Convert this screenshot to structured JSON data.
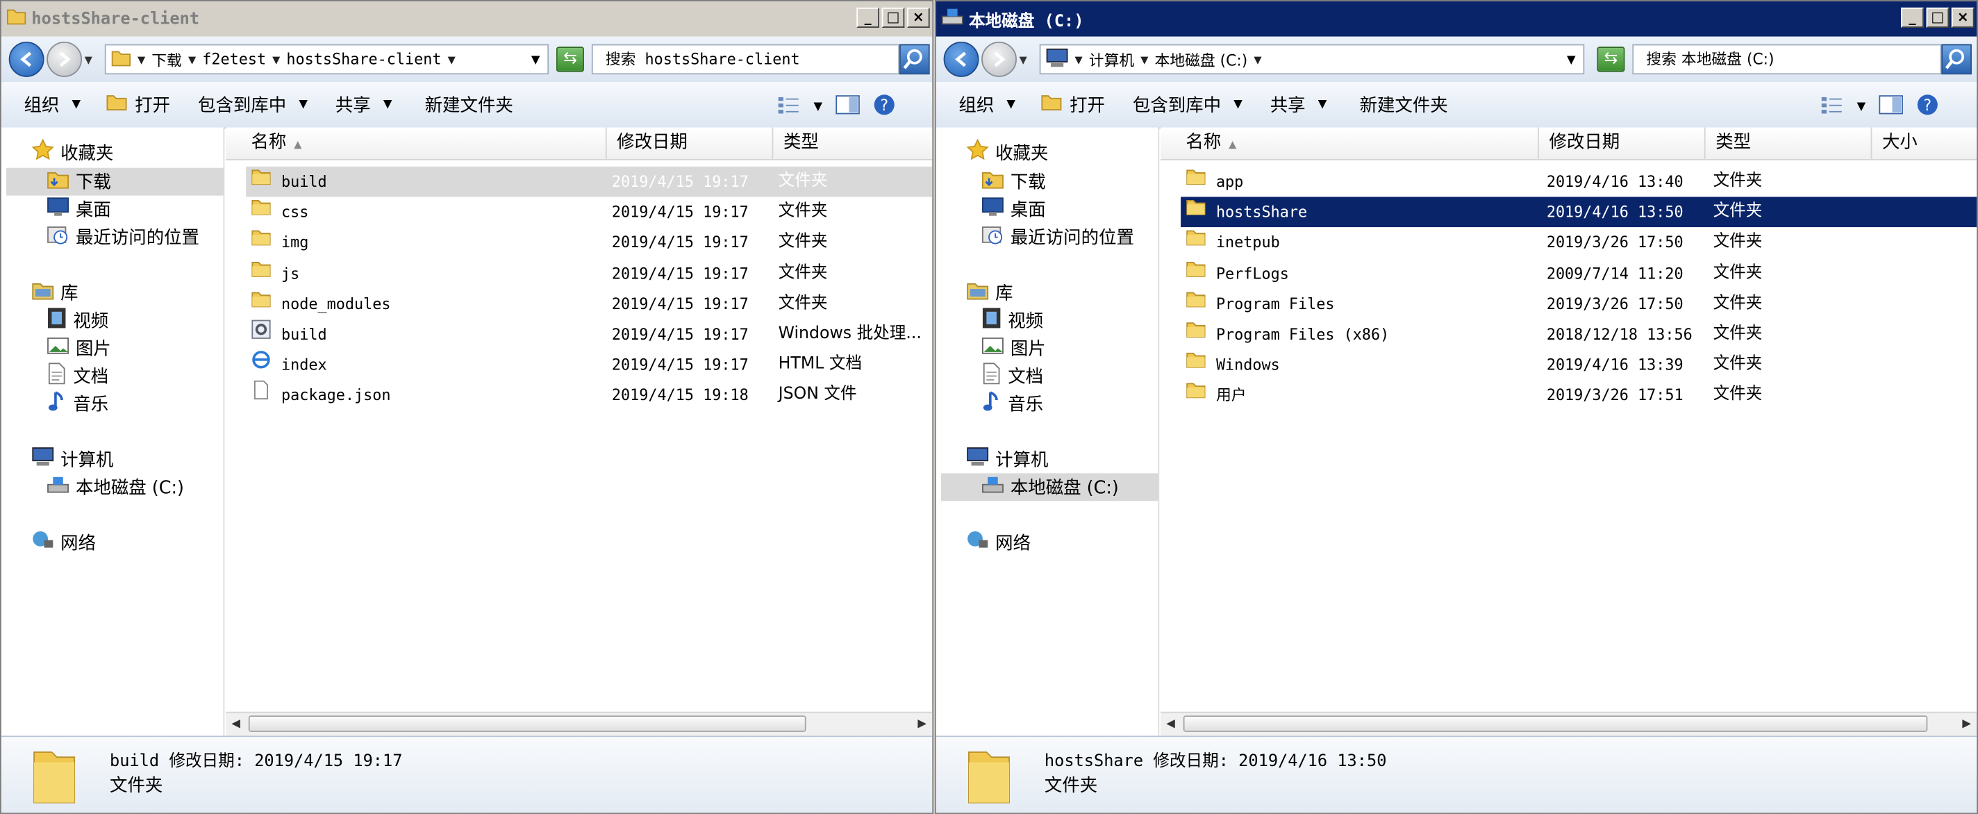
{
  "left_window": {
    "title": "hostsShare-client",
    "breadcrumb": [
      "下载",
      "f2etest",
      "hostsShare-client"
    ],
    "search_placeholder": "搜索 hostsShare-client",
    "toolbar": {
      "organize": "组织",
      "open": "打开",
      "include_library": "包含到库中",
      "share": "共享",
      "new_folder": "新建文件夹"
    },
    "nav": {
      "favorites": "收藏夹",
      "downloads": "下载",
      "desktop": "桌面",
      "recent": "最近访问的位置",
      "libraries": "库",
      "videos": "视频",
      "pictures": "图片",
      "documents": "文档",
      "music": "音乐",
      "computer": "计算机",
      "local_disk": "本地磁盘 (C:)",
      "network": "网络"
    },
    "columns": {
      "name": "名称",
      "date": "修改日期",
      "type": "类型"
    },
    "files": [
      {
        "name": "build",
        "date": "2019/4/15 19:17",
        "type": "文件夹",
        "icon": "folder-icon"
      },
      {
        "name": "css",
        "date": "2019/4/15 19:17",
        "type": "文件夹",
        "icon": "folder-icon"
      },
      {
        "name": "img",
        "date": "2019/4/15 19:17",
        "type": "文件夹",
        "icon": "folder-icon"
      },
      {
        "name": "js",
        "date": "2019/4/15 19:17",
        "type": "文件夹",
        "icon": "folder-icon"
      },
      {
        "name": "node_modules",
        "date": "2019/4/15 19:17",
        "type": "文件夹",
        "icon": "folder-icon"
      },
      {
        "name": "build",
        "date": "2019/4/15 19:17",
        "type": "Windows 批处理...",
        "icon": "batch-file-icon"
      },
      {
        "name": "index",
        "date": "2019/4/15 19:17",
        "type": "HTML 文档",
        "icon": "html-file-icon"
      },
      {
        "name": "package.json",
        "date": "2019/4/15 19:18",
        "type": "JSON 文件",
        "icon": "document-icon"
      }
    ],
    "details": {
      "line1": "build 修改日期: 2019/4/15 19:17",
      "line2": "文件夹"
    }
  },
  "right_window": {
    "title": "本地磁盘 (C:)",
    "breadcrumb": [
      "计算机",
      "本地磁盘 (C:)"
    ],
    "search_placeholder": "搜索 本地磁盘 (C:)",
    "toolbar": {
      "organize": "组织",
      "open": "打开",
      "include_library": "包含到库中",
      "share": "共享",
      "new_folder": "新建文件夹"
    },
    "nav": {
      "favorites": "收藏夹",
      "downloads": "下载",
      "desktop": "桌面",
      "recent": "最近访问的位置",
      "libraries": "库",
      "videos": "视频",
      "pictures": "图片",
      "documents": "文档",
      "music": "音乐",
      "computer": "计算机",
      "local_disk": "本地磁盘 (C:)",
      "network": "网络"
    },
    "columns": {
      "name": "名称",
      "date": "修改日期",
      "type": "类型",
      "size": "大小"
    },
    "files": [
      {
        "name": "app",
        "date": "2019/4/16 13:40",
        "type": "文件夹"
      },
      {
        "name": "hostsShare",
        "date": "2019/4/16 13:50",
        "type": "文件夹"
      },
      {
        "name": "inetpub",
        "date": "2019/3/26 17:50",
        "type": "文件夹"
      },
      {
        "name": "PerfLogs",
        "date": "2009/7/14 11:20",
        "type": "文件夹"
      },
      {
        "name": "Program Files",
        "date": "2019/3/26 17:50",
        "type": "文件夹"
      },
      {
        "name": "Program Files (x86)",
        "date": "2018/12/18 13:56",
        "type": "文件夹"
      },
      {
        "name": "Windows",
        "date": "2019/4/16 13:39",
        "type": "文件夹"
      },
      {
        "name": "用户",
        "date": "2019/3/26 17:51",
        "type": "文件夹"
      }
    ],
    "details": {
      "line1": "hostsShare 修改日期: 2019/4/16 13:50",
      "line2": "文件夹"
    }
  },
  "colors": {
    "active_title": "#0a246a",
    "inactive_title": "#d4d0c8",
    "selection_blue": "#0a246a",
    "selection_gray": "#d9d9d9"
  }
}
